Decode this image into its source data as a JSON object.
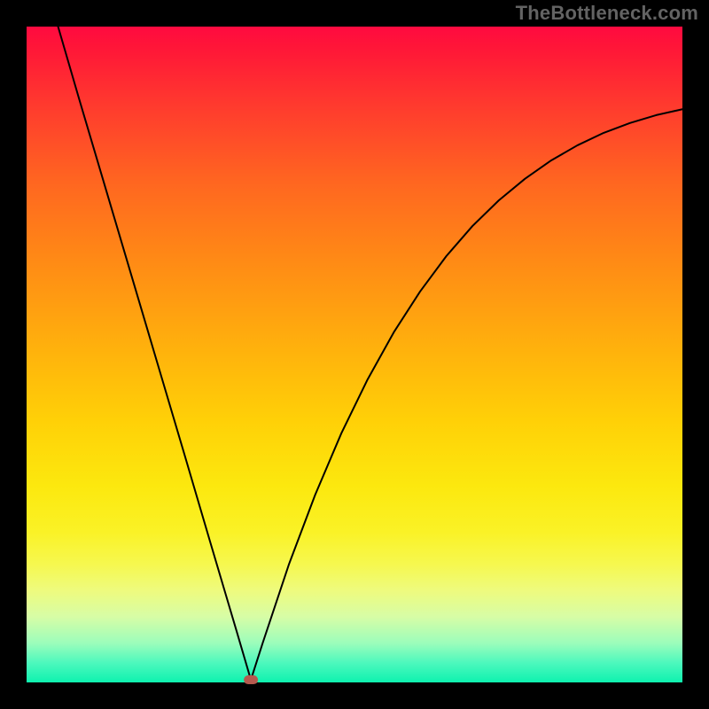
{
  "watermark": "TheBottleneck.com",
  "chart_data": {
    "type": "line",
    "title": "",
    "xlabel": "",
    "ylabel": "",
    "xlim": [
      0,
      100
    ],
    "ylim": [
      0,
      100
    ],
    "background_gradient": {
      "top_color": "#ff0a40",
      "bottom_color": "#0ef2af",
      "note": "red (high bottleneck) at top to green (low bottleneck) at bottom"
    },
    "series": [
      {
        "name": "bottleneck-curve",
        "note": "V-shaped bottleneck curve; y ≈ bottleneck %, x ≈ component balance axis. Minimum (optimal point) near x≈34.",
        "x": [
          4.8,
          8,
          12,
          16,
          20,
          24,
          28,
          32,
          34.2,
          36,
          40,
          44,
          48,
          52,
          56,
          60,
          64,
          68,
          72,
          76,
          80,
          84,
          88,
          92,
          96,
          100
        ],
        "values": [
          100,
          89,
          75.5,
          62,
          48.5,
          35,
          21.4,
          7.9,
          0.4,
          6,
          18,
          28.6,
          38,
          46.2,
          53.4,
          59.6,
          65,
          69.6,
          73.5,
          76.8,
          79.6,
          81.9,
          83.8,
          85.3,
          86.5,
          87.4
        ]
      }
    ],
    "marker": {
      "name": "optimal-point",
      "x": 34.2,
      "y": 0.4,
      "color": "#b5594e",
      "shape": "rounded-rect"
    }
  }
}
